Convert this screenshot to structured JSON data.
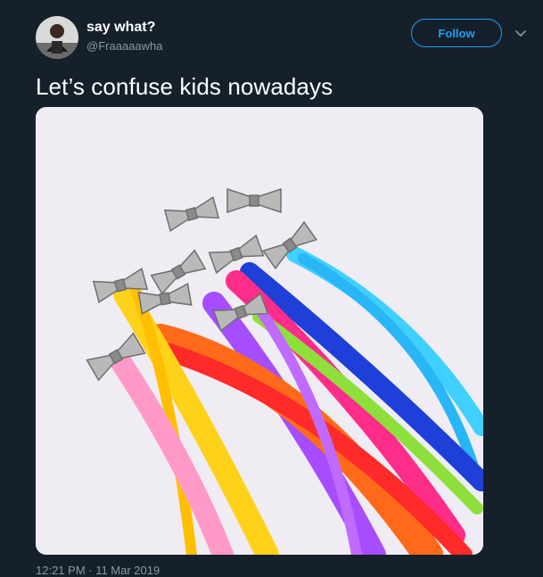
{
  "user": {
    "display_name": "say what?",
    "handle": "@Fraaaaawha"
  },
  "header": {
    "follow_label": "Follow"
  },
  "icons": {
    "more": "chevron-down-icon"
  },
  "tweet": {
    "text": "Let’s confuse kids nowadays",
    "timestamp": "12:21 PM · 11 Mar 2019"
  },
  "colors": {
    "background": "#15202b",
    "accent": "#1da1f2",
    "secondary_text": "#8899a6",
    "primary_text": "#ffffff"
  }
}
